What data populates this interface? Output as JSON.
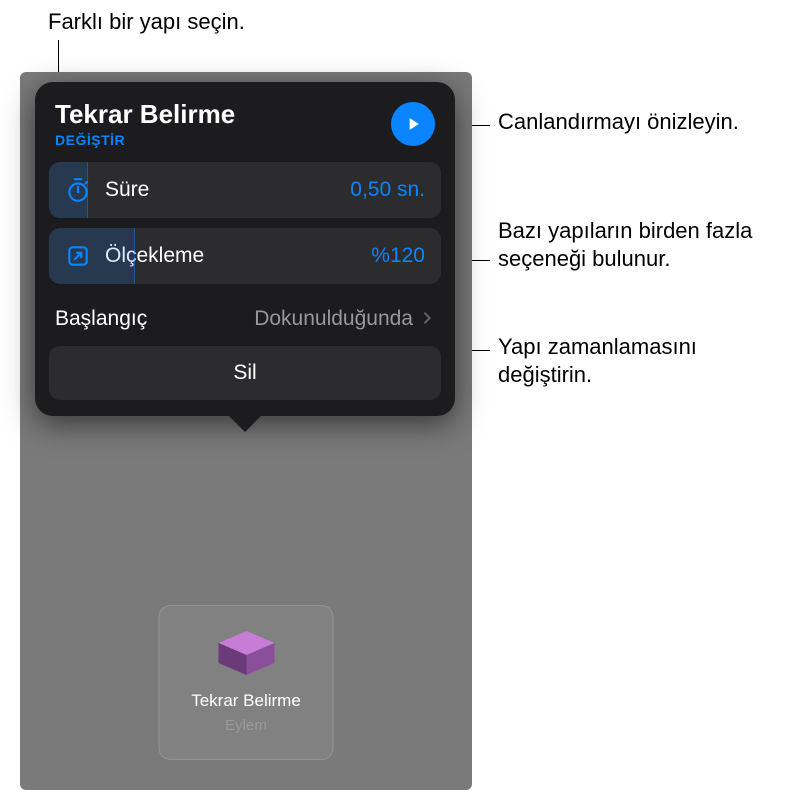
{
  "callouts": {
    "chooseBuild": "Farklı bir yapı seçin.",
    "preview": "Canlandırmayı önizleyin.",
    "multipleOptions": "Bazı yapıların birden fazla seçeneği bulunur.",
    "changeTiming": "Yapı zamanlamasını değiştirin."
  },
  "popover": {
    "title": "Tekrar Belirme",
    "changeLabel": "DEĞİŞTİR",
    "duration": {
      "label": "Süre",
      "value": "0,50 sn.",
      "fillPercent": 10
    },
    "scale": {
      "label": "Ölçekleme",
      "value": "%120",
      "fillPercent": 22
    },
    "start": {
      "label": "Başlangıç",
      "value": "Dokunulduğunda"
    },
    "deleteLabel": "Sil"
  },
  "tile": {
    "name": "Tekrar Belirme",
    "type": "Eylem"
  }
}
